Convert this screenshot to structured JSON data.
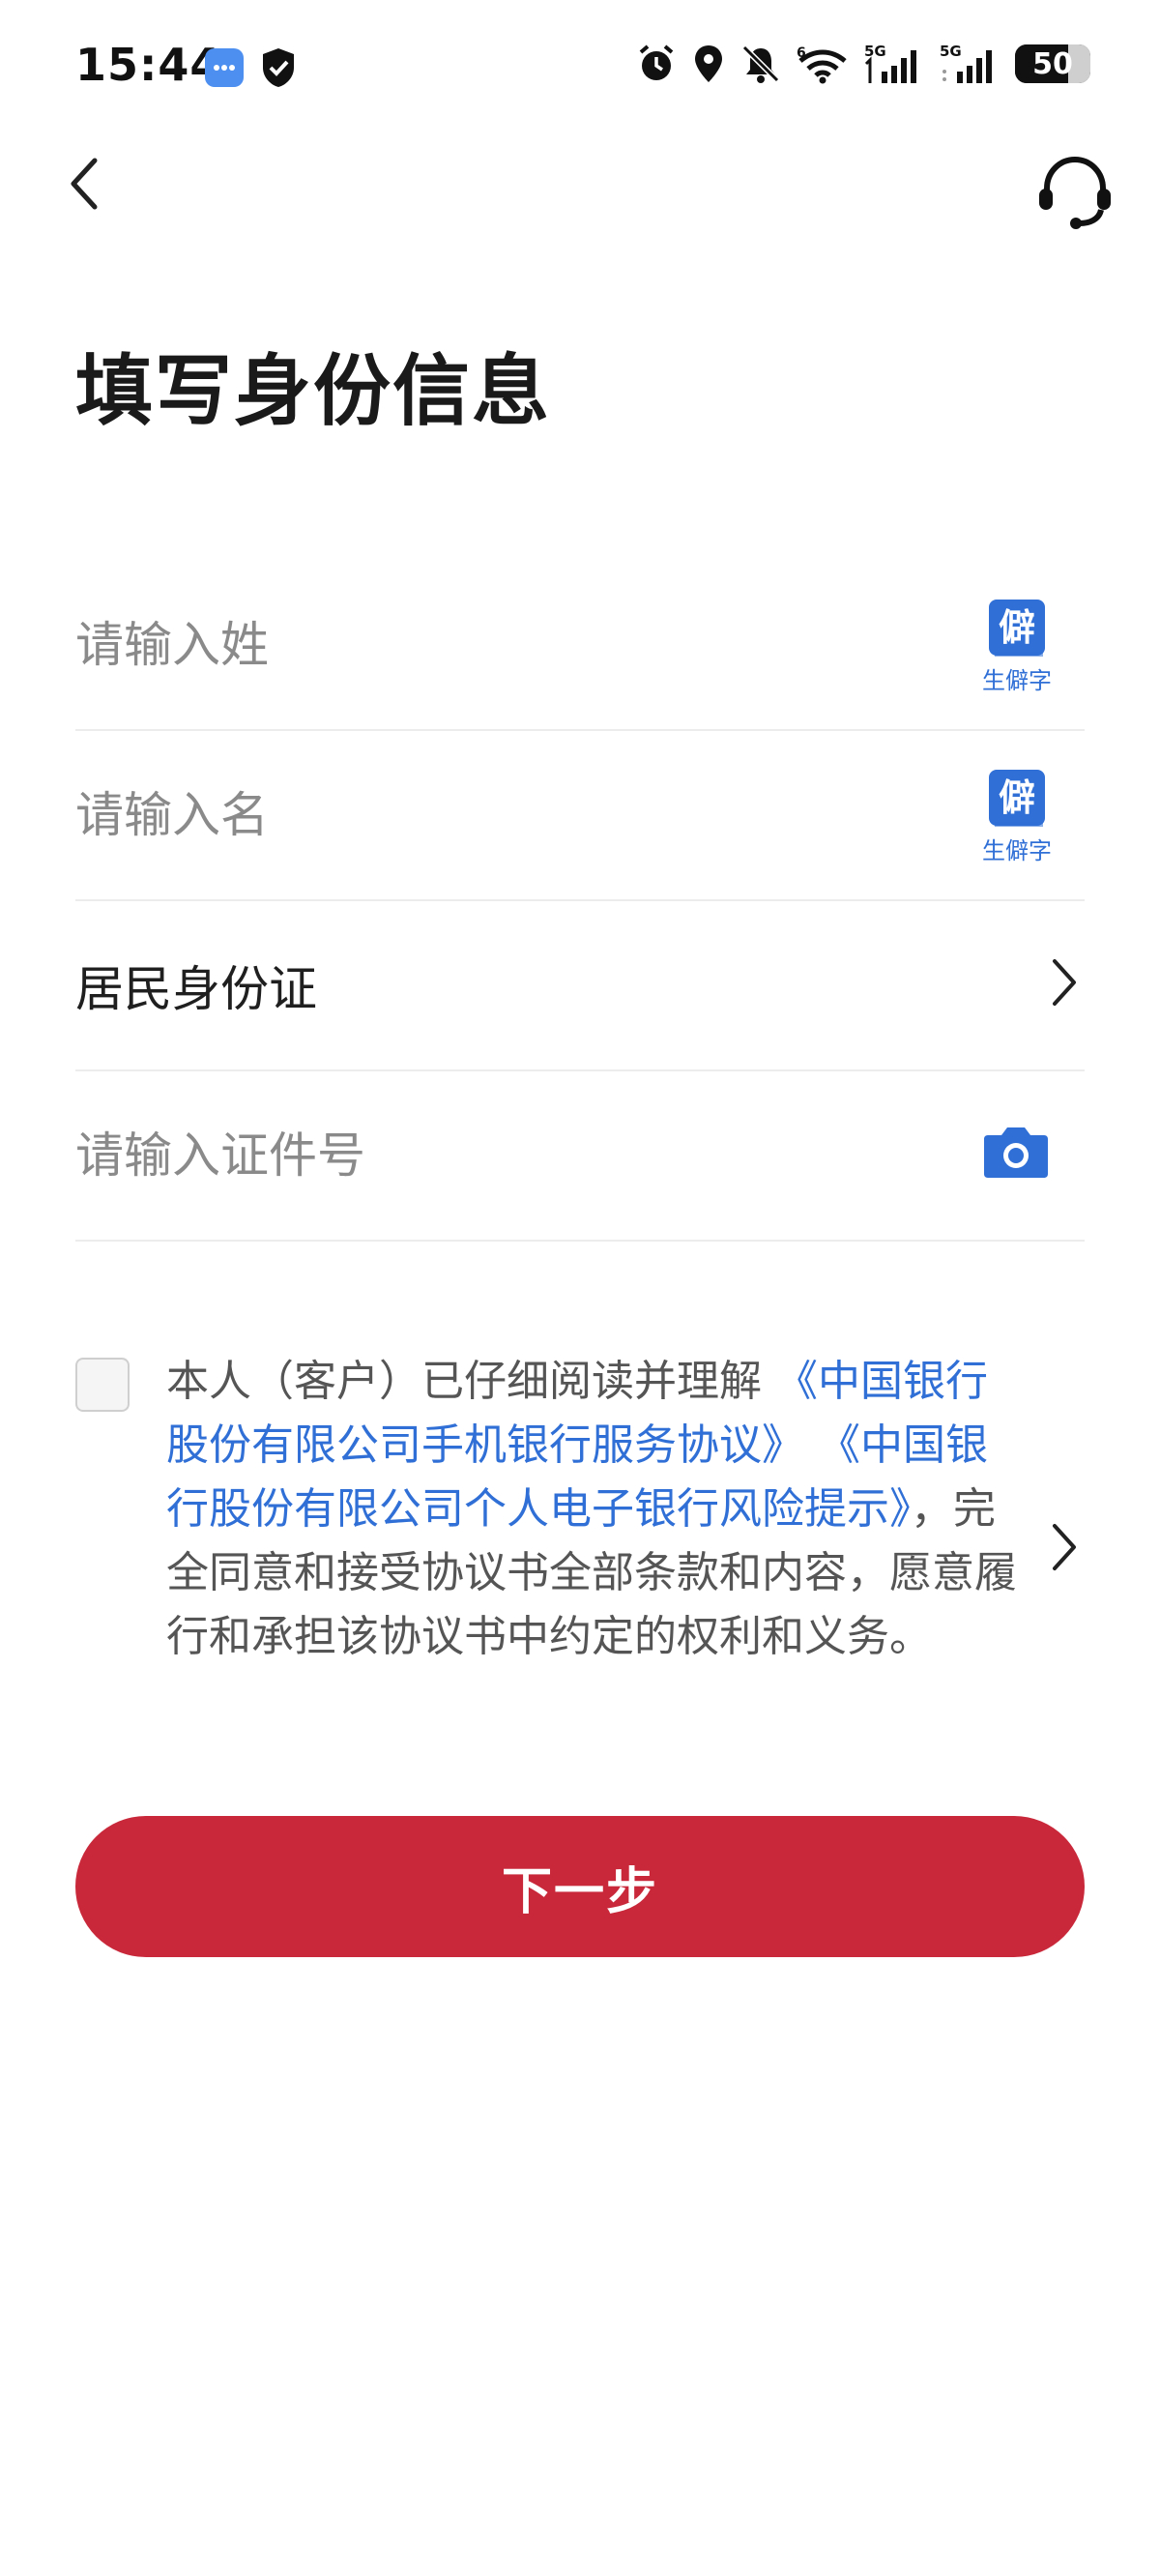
{
  "status_bar": {
    "time": "15:44",
    "battery": "50",
    "network_1": "5G",
    "network_2": "5G",
    "wifi_badge": "6"
  },
  "header": {
    "title": "填写身份信息"
  },
  "form": {
    "surname_placeholder": "请输入姓",
    "given_name_placeholder": "请输入名",
    "rare_char_label": "生僻字",
    "rare_char_icon_text": "僻",
    "id_type_value": "居民身份证",
    "id_number_placeholder": "请输入证件号"
  },
  "agreement": {
    "prefix": "本人（客户）已仔细阅读并理解",
    "link_1": "《中国银行股份有限公司手机银行服务协议》",
    "link_2": "《中国银行股份有限公司个人电子银行风险提示》",
    "suffix": "，完全同意和接受协议书全部条款和内容，愿意履行和承担该协议书中约定的权利和义务。",
    "checked": false
  },
  "actions": {
    "next_label": "下一步"
  },
  "colors": {
    "accent_red": "#c9283a",
    "link_blue": "#2f6fd6"
  }
}
